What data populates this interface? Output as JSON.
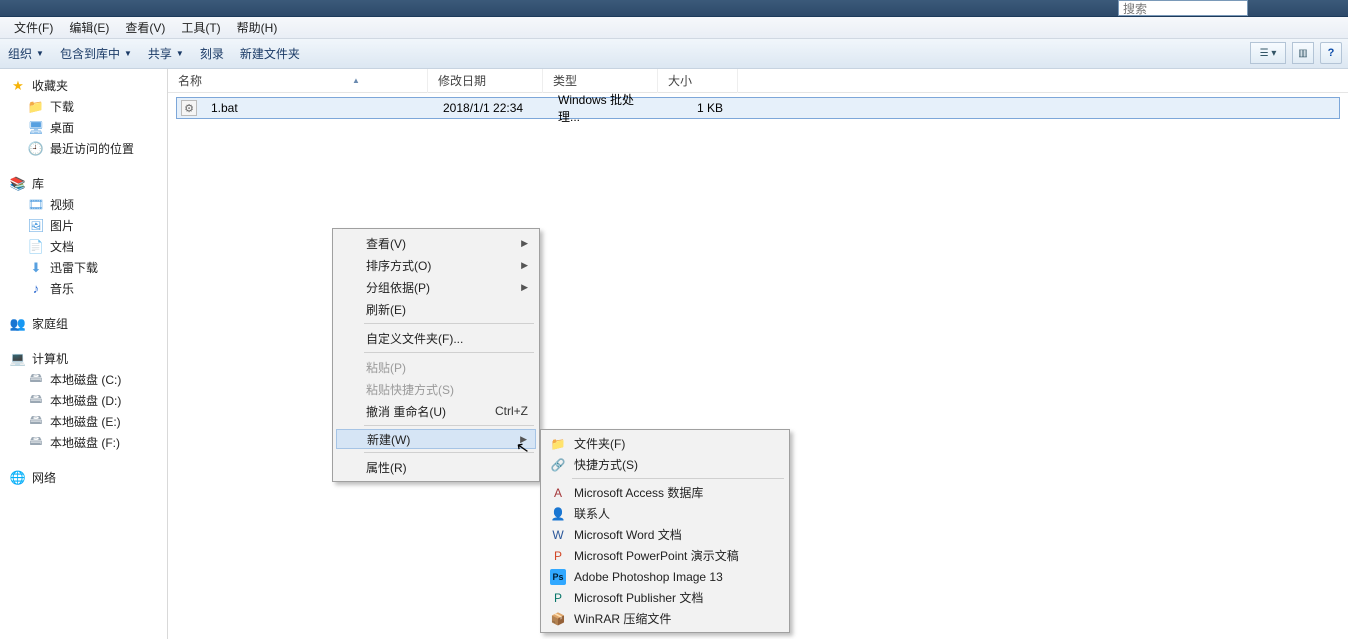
{
  "title_bar": {
    "search_placeholder": "搜索"
  },
  "menu_bar": {
    "file": "文件(F)",
    "edit": "编辑(E)",
    "view": "查看(V)",
    "tools": "工具(T)",
    "help": "帮助(H)"
  },
  "toolbar": {
    "organize": "组织",
    "include": "包含到库中",
    "share": "共享",
    "burn": "刻录",
    "new_folder": "新建文件夹"
  },
  "sidebar": {
    "favorites": {
      "head": "收藏夹",
      "items": [
        "下载",
        "桌面",
        "最近访问的位置"
      ]
    },
    "libraries": {
      "head": "库",
      "items": [
        "视频",
        "图片",
        "文档",
        "迅雷下载",
        "音乐"
      ]
    },
    "homegroup": {
      "head": "家庭组"
    },
    "computer": {
      "head": "计算机",
      "items": [
        "本地磁盘 (C:)",
        "本地磁盘 (D:)",
        "本地磁盘 (E:)",
        "本地磁盘 (F:)"
      ]
    },
    "network": {
      "head": "网络"
    }
  },
  "columns": {
    "name": "名称",
    "date": "修改日期",
    "type": "类型",
    "size": "大小"
  },
  "files": [
    {
      "name": "1.bat",
      "date": "2018/1/1 22:34",
      "type": "Windows 批处理...",
      "size": "1 KB"
    }
  ],
  "context_menu": {
    "view": "查看(V)",
    "sort": "排序方式(O)",
    "group": "分组依据(P)",
    "refresh": "刷新(E)",
    "customize": "自定义文件夹(F)...",
    "paste": "粘贴(P)",
    "paste_shortcut": "粘贴快捷方式(S)",
    "undo": "撤消 重命名(U)",
    "undo_short": "Ctrl+Z",
    "neww": "新建(W)",
    "properties": "属性(R)"
  },
  "new_submenu": {
    "folder": "文件夹(F)",
    "shortcut": "快捷方式(S)",
    "access": "Microsoft Access 数据库",
    "contact": "联系人",
    "word": "Microsoft Word 文档",
    "ppt": "Microsoft PowerPoint 演示文稿",
    "ps": "Adobe Photoshop Image 13",
    "pub": "Microsoft Publisher 文档",
    "rar": "WinRAR 压缩文件"
  },
  "colors": {
    "accent": "#1a3a66"
  }
}
